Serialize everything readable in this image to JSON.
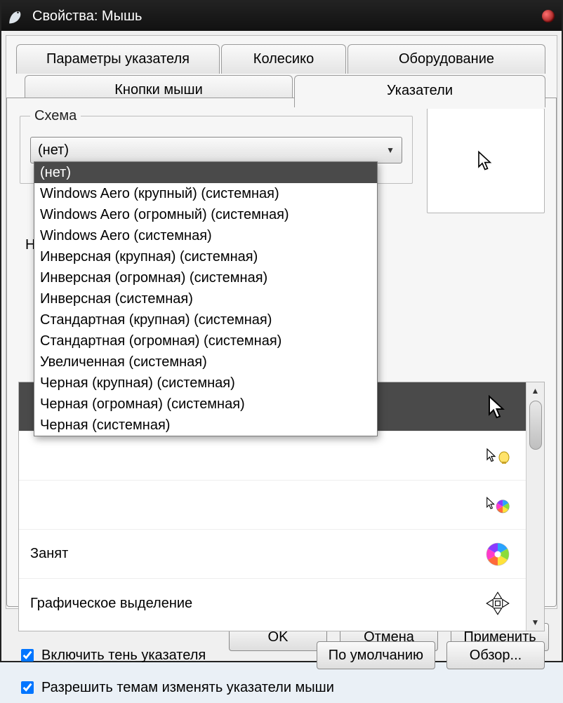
{
  "window": {
    "title": "Свойства: Мышь"
  },
  "tabs": {
    "row1": [
      "Параметры указателя",
      "Колесико",
      "Оборудование"
    ],
    "row2": [
      "Кнопки мыши",
      "Указатели"
    ]
  },
  "scheme": {
    "legend": "Схема",
    "selected": "(нет)",
    "options": [
      "(нет)",
      "Windows Aero (крупный) (системная)",
      "Windows Aero (огромный) (системная)",
      "Windows Aero (системная)",
      "Инверсная (крупная) (системная)",
      "Инверсная (огромная) (системная)",
      "Инверсная (системная)",
      "Стандартная (крупная) (системная)",
      "Стандартная (огромная) (системная)",
      "Увеличенная (системная)",
      "Черная (крупная) (системная)",
      "Черная (огромная) (системная)",
      "Черная (системная)"
    ]
  },
  "customize_label": "На",
  "cursor_list": {
    "items": [
      {
        "label": "",
        "icon": "arrow"
      },
      {
        "label": "",
        "icon": "arrow-help"
      },
      {
        "label": "",
        "icon": "arrow-busy"
      },
      {
        "label": "Занят",
        "icon": "busy"
      },
      {
        "label": "Графическое выделение",
        "icon": "move"
      }
    ]
  },
  "checkboxes": {
    "shadow": "Включить тень указателя",
    "themes": "Разрешить темам изменять указатели мыши"
  },
  "buttons": {
    "defaults": "По умолчанию",
    "browse": "Обзор...",
    "ok": "OK",
    "cancel": "Отмена",
    "apply": "Применить"
  }
}
